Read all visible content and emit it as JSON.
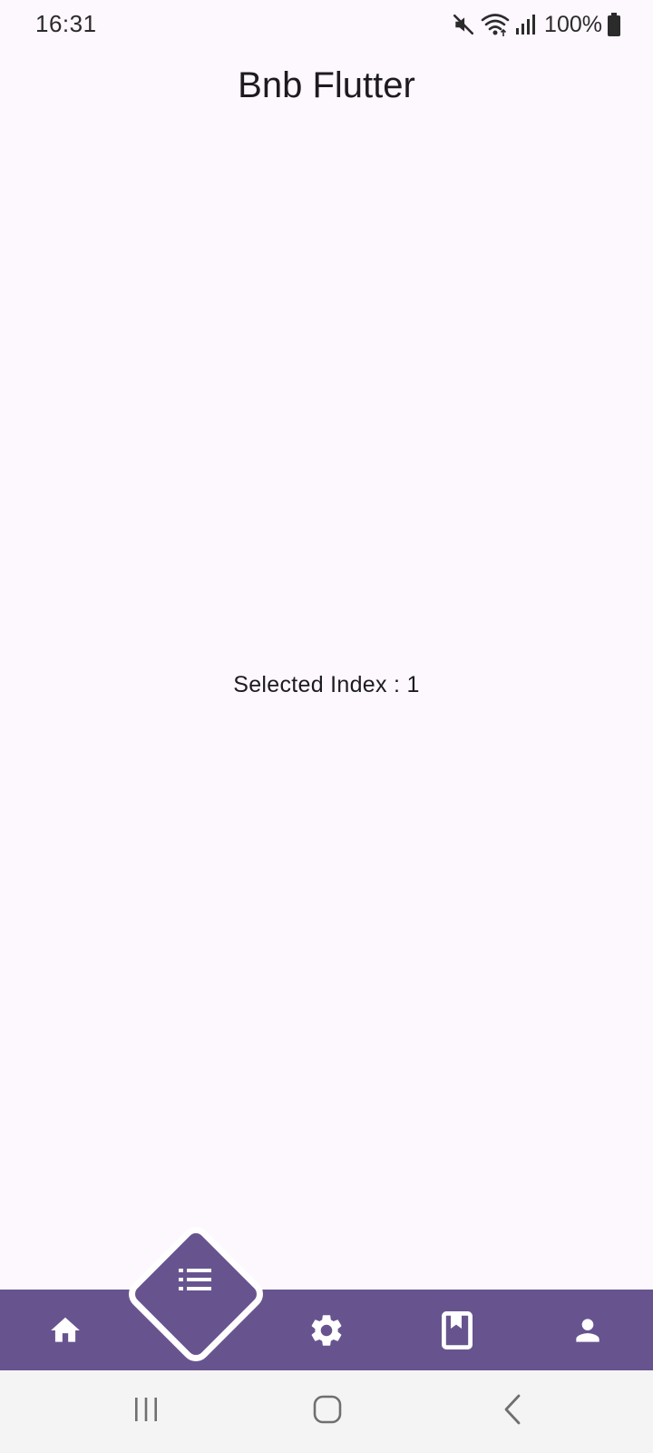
{
  "status_bar": {
    "time": "16:31",
    "battery_percent": "100%",
    "icons": [
      "mute-icon",
      "wifi-icon",
      "signal-icon",
      "battery-icon"
    ]
  },
  "app_bar": {
    "title": "Bnb Flutter"
  },
  "content": {
    "text": "Selected Index : 1"
  },
  "bottom_nav": {
    "background_color": "#67548f",
    "icon_color": "#ffffff",
    "selected_index": 1,
    "items": [
      {
        "icon": "home-icon"
      },
      {
        "icon": "list-icon"
      },
      {
        "icon": "settings-icon"
      },
      {
        "icon": "book-icon"
      },
      {
        "icon": "person-icon"
      }
    ]
  },
  "system_nav": {
    "buttons": [
      "recent-apps-icon",
      "home-circle-icon",
      "back-icon"
    ]
  },
  "colors": {
    "background": "#fdf7fe",
    "accent": "#67548f"
  }
}
